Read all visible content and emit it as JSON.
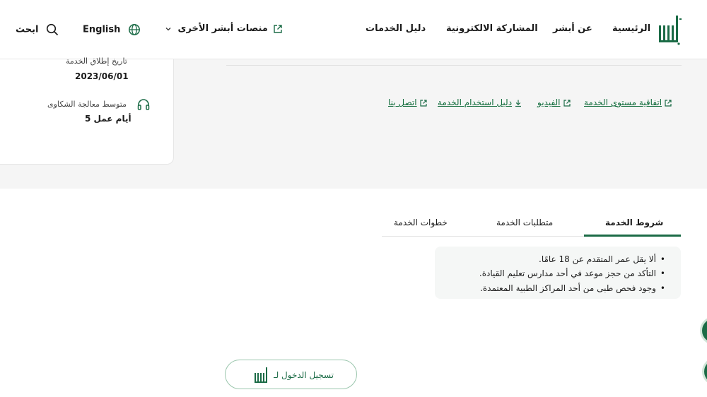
{
  "header": {
    "nav": {
      "home": "الرئيسية",
      "about": "عن أبشر",
      "eparticipation": "المشاركة الالكترونية",
      "services_guide": "دليل الخدمات",
      "other_platforms": "منصات أبشر الأخرى",
      "language": "English",
      "search": "ابحث"
    }
  },
  "service_info": {
    "launch_label": "تاريخ إطلاق الخدمة",
    "launch_value": "2023/06/01",
    "complaints_label": "متوسط معالجة الشكاوى",
    "complaints_value": "5 أيام عمل"
  },
  "links": {
    "sla": "اتفاقية مستوى الخدمة",
    "video": "الفيديو",
    "user_guide": "دليل استخدام الخدمة",
    "contact": "اتصل بنا"
  },
  "tabs": {
    "conditions": "شروط الخدمة",
    "requirements": "متطلبات الخدمة",
    "steps": "خطوات الخدمة"
  },
  "conditions": [
    "ألا يقل عمر المتقدم عن 18 عامًا.",
    "التأكد من حجز موعد في أحد مدارس تعليم القيادة.",
    "وجود فحص طبى من أحد المراكز الطبية المعتمدة."
  ],
  "login": {
    "label": "تسجيل الدخول لـ"
  },
  "colors": {
    "brand": "#1b6b46",
    "link": "#0f6b3a",
    "section_bg": "#f5f5f5"
  },
  "icons": [
    "abshir-logo",
    "external-link-icon",
    "chevron-down-icon",
    "globe-icon",
    "search-icon",
    "headphones-icon",
    "download-icon"
  ]
}
